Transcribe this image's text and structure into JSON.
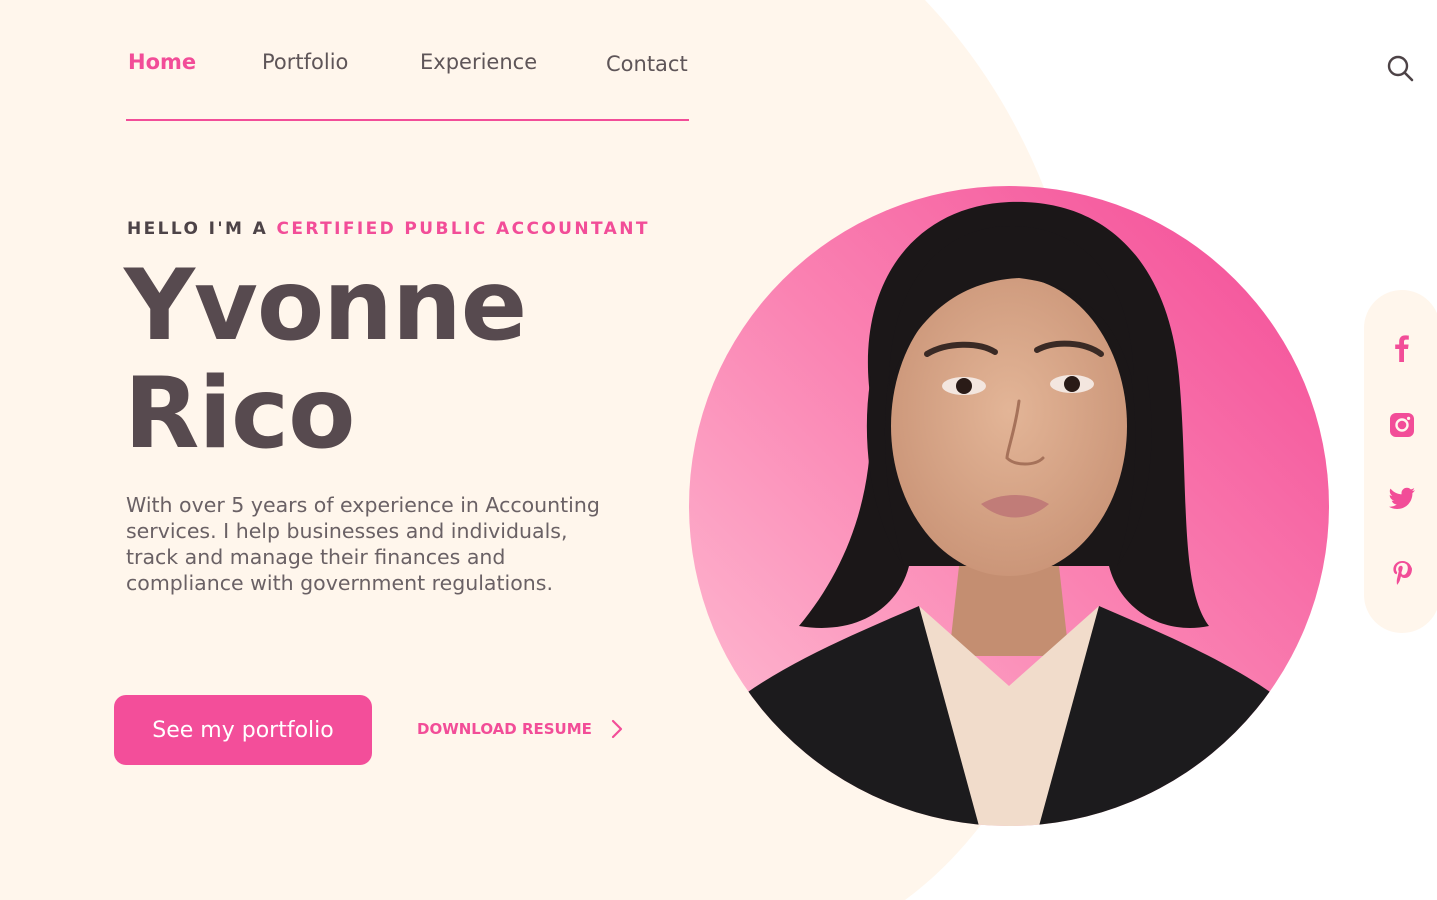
{
  "nav": {
    "items": [
      {
        "label": "Home",
        "active": true
      },
      {
        "label": "Portfolio",
        "active": false
      },
      {
        "label": "Experience",
        "active": false
      },
      {
        "label": "Contact",
        "active": false
      }
    ],
    "search_icon": "search-icon"
  },
  "hero": {
    "eyebrow_prefix": "HELLO I'M A ",
    "eyebrow_accent": "CERTIFIED PUBLIC ACCOUNTANT",
    "first_name": "Yvonne",
    "last_name": "Rico",
    "description": "With over 5 years of experience in Accounting services. I help businesses and individuals, track and manage their finances and compliance with government regulations."
  },
  "actions": {
    "primary_label": "See my portfolio",
    "secondary_label": "DOWNLOAD RESUME",
    "secondary_icon": "chevron-right-icon"
  },
  "portrait": {
    "icon": "profile-photo"
  },
  "social": {
    "icons": [
      "facebook-icon",
      "instagram-icon",
      "twitter-icon",
      "pinterest-icon"
    ]
  },
  "colors": {
    "accent": "#f24d98",
    "cream": "#fff6ec",
    "heading": "#574a4f",
    "body_text": "#6a6165"
  }
}
